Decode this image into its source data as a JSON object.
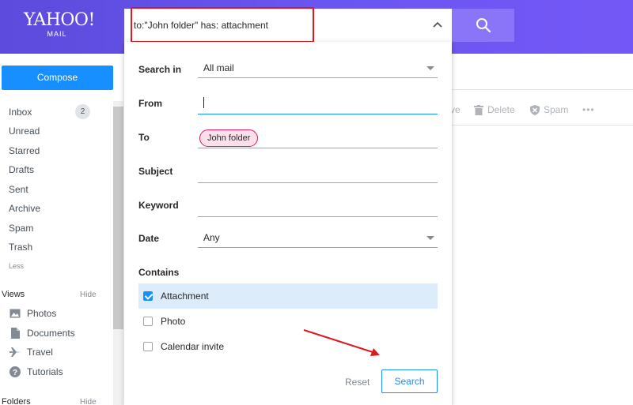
{
  "header": {
    "logo_main": "YAHOO!",
    "logo_sub": "MAIL",
    "search_query": "to:\"John folder\" has: attachment"
  },
  "sidebar": {
    "compose_label": "Compose",
    "folders": [
      {
        "label": "Inbox",
        "count": "2"
      },
      {
        "label": "Unread"
      },
      {
        "label": "Starred"
      },
      {
        "label": "Drafts"
      },
      {
        "label": "Sent"
      },
      {
        "label": "Archive"
      },
      {
        "label": "Spam"
      },
      {
        "label": "Trash"
      }
    ],
    "less_label": "Less",
    "views_label": "Views",
    "views_hide": "Hide",
    "views": [
      {
        "label": "Photos",
        "icon": "photo-icon"
      },
      {
        "label": "Documents",
        "icon": "document-icon"
      },
      {
        "label": "Travel",
        "icon": "plane-icon"
      },
      {
        "label": "Tutorials",
        "icon": "help-icon"
      }
    ],
    "folders_label": "Folders",
    "folders_hide": "Hide"
  },
  "toolbar": {
    "move_partial": "ve",
    "delete_label": "Delete",
    "spam_label": "Spam",
    "more_label": "•••"
  },
  "advanced_search": {
    "search_in_label": "Search in",
    "search_in_value": "All mail",
    "from_label": "From",
    "from_value": "",
    "to_label": "To",
    "to_chip": "John folder",
    "subject_label": "Subject",
    "subject_value": "",
    "keyword_label": "Keyword",
    "keyword_value": "",
    "date_label": "Date",
    "date_value": "Any",
    "contains_label": "Contains",
    "contains_options": [
      {
        "label": "Attachment",
        "checked": true
      },
      {
        "label": "Photo",
        "checked": false
      },
      {
        "label": "Calendar invite",
        "checked": false
      }
    ],
    "reset_label": "Reset",
    "search_label": "Search"
  },
  "colors": {
    "header_start": "#5c4bdc",
    "header_end": "#7458f7",
    "accent_blue": "#188fff",
    "highlight_red": "#e0191f",
    "chip_pink": "#e0195d"
  }
}
